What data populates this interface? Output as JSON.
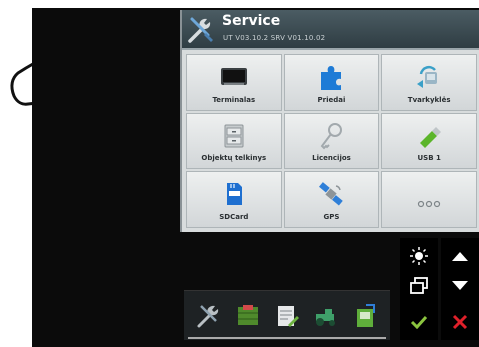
{
  "window": {
    "title": "Service",
    "subtitle": "UT V03.10.2  SRV V01.10.02",
    "icon": "wrench-screwdriver-icon"
  },
  "tiles": [
    {
      "label": "Terminalas",
      "icon": "terminal-screen-icon"
    },
    {
      "label": "Priedai",
      "icon": "puzzle-piece-icon"
    },
    {
      "label": "Tvarkyklės",
      "icon": "driver-install-icon"
    },
    {
      "label": "Objektų telkinys",
      "icon": "file-cabinet-icon"
    },
    {
      "label": "Licencijos",
      "icon": "key-icon"
    },
    {
      "label": "USB 1",
      "icon": "usb-stick-icon"
    },
    {
      "label": "SDCard",
      "icon": "sd-card-icon"
    },
    {
      "label": "GPS",
      "icon": "satellite-icon"
    },
    {
      "label": "",
      "icon": "more-dots-icon"
    }
  ],
  "controls": {
    "brightness": "brightness-icon",
    "up": "arrow-up-icon",
    "switch_window": "window-switch-icon",
    "down": "arrow-down-icon",
    "confirm": "check-icon",
    "cancel": "close-icon"
  },
  "toolbar": [
    "service-tools-icon",
    "field-map-icon",
    "notes-icon",
    "tractor-icon",
    "document-export-icon"
  ],
  "colors": {
    "header": "#3a4a50",
    "confirm": "#8bc43f",
    "cancel": "#e0202a",
    "accent_blue": "#1e7bd6"
  }
}
